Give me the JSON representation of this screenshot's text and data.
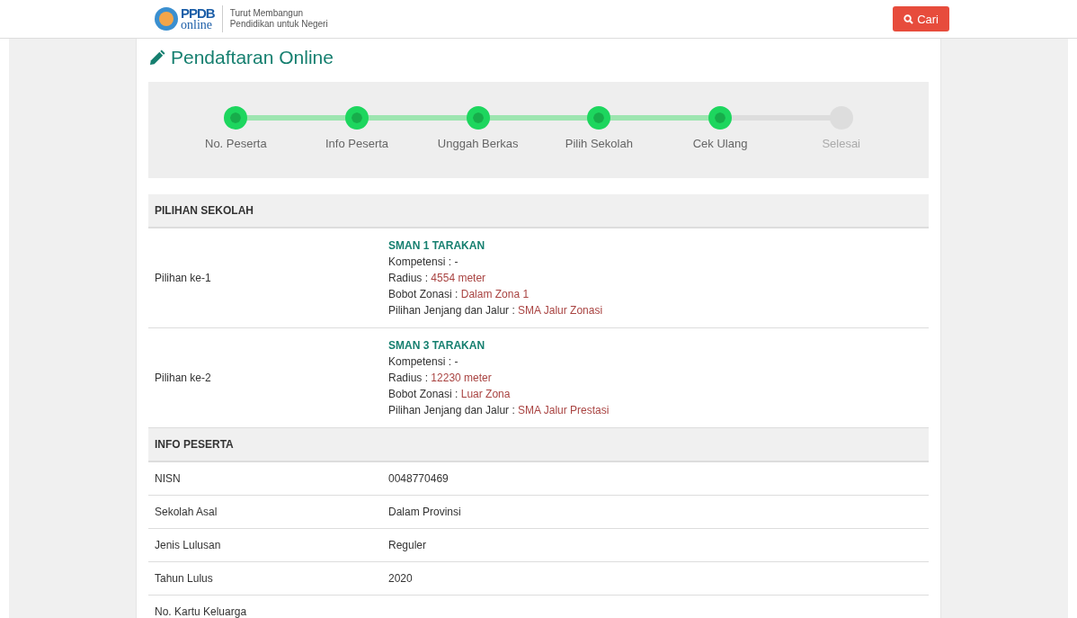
{
  "header": {
    "logo_top": "PPDB",
    "logo_bottom": "online",
    "tagline_1": "Turut Membangun",
    "tagline_2": "Pendidikan untuk Negeri",
    "search_button": "Cari"
  },
  "title": "Pendaftaran Online",
  "steps": [
    {
      "label": "No. Peserta",
      "done": true
    },
    {
      "label": "Info Peserta",
      "done": true
    },
    {
      "label": "Unggah Berkas",
      "done": true
    },
    {
      "label": "Pilih Sekolah",
      "done": true
    },
    {
      "label": "Cek Ulang",
      "done": true
    },
    {
      "label": "Selesai",
      "done": false
    }
  ],
  "pilihan_sekolah": {
    "heading": "PILIHAN SEKOLAH",
    "rows": [
      {
        "label": "Pilihan ke-1",
        "school": "SMAN 1 TARAKAN",
        "lines": [
          {
            "label": "Kompetensi : ",
            "value": "-",
            "accent": false
          },
          {
            "label": "Radius : ",
            "value": "4554 meter",
            "accent": true
          },
          {
            "label": "Bobot Zonasi : ",
            "value": "Dalam Zona 1",
            "accent": true
          },
          {
            "label": "Pilihan Jenjang dan Jalur : ",
            "value": "SMA Jalur Zonasi",
            "accent": true
          }
        ]
      },
      {
        "label": "Pilihan ke-2",
        "school": "SMAN 3 TARAKAN",
        "lines": [
          {
            "label": "Kompetensi : ",
            "value": "-",
            "accent": false
          },
          {
            "label": "Radius : ",
            "value": "12230 meter",
            "accent": true
          },
          {
            "label": "Bobot Zonasi : ",
            "value": "Luar Zona",
            "accent": true
          },
          {
            "label": "Pilihan Jenjang dan Jalur : ",
            "value": "SMA Jalur Prestasi",
            "accent": true
          }
        ]
      }
    ]
  },
  "info_peserta": {
    "heading": "INFO PESERTA",
    "rows": [
      {
        "label": "NISN",
        "value": "0048770469"
      },
      {
        "label": "Sekolah Asal",
        "value": "Dalam Provinsi"
      },
      {
        "label": "Jenis Lulusan",
        "value": "Reguler"
      },
      {
        "label": "Tahun Lulus",
        "value": "2020"
      },
      {
        "label": "No. Kartu Keluarga"
      }
    ]
  }
}
